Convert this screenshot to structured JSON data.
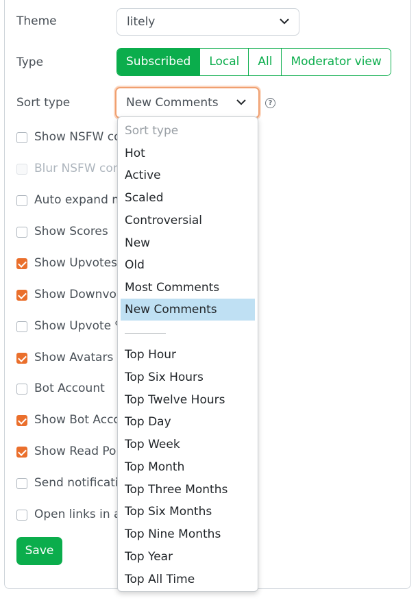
{
  "form": {
    "theme_label": "Theme",
    "theme_value": "litely",
    "type_label": "Type",
    "type_options": [
      "Subscribed",
      "Local",
      "All",
      "Moderator view"
    ],
    "type_selected": "Subscribed",
    "sort_label": "Sort type",
    "sort_value": "New Comments",
    "help_icon": "?",
    "save_label": "Save"
  },
  "checkboxes": [
    {
      "label": "Show NSFW co",
      "checked": false,
      "disabled": false
    },
    {
      "label": "Blur NSFW con",
      "checked": false,
      "disabled": true
    },
    {
      "label": "Auto expand m",
      "checked": false,
      "disabled": false
    },
    {
      "label": "Show Scores",
      "checked": false,
      "disabled": false
    },
    {
      "label": "Show Upvotes",
      "checked": true,
      "disabled": false
    },
    {
      "label": "Show Downvo",
      "checked": true,
      "disabled": false
    },
    {
      "label": "Show Upvote %",
      "checked": false,
      "disabled": false
    },
    {
      "label": "Show Avatars",
      "checked": true,
      "disabled": false
    },
    {
      "label": "Bot Account",
      "checked": false,
      "disabled": false
    },
    {
      "label": "Show Bot Acco",
      "checked": true,
      "disabled": false
    },
    {
      "label": "Show Read Po",
      "checked": true,
      "disabled": false
    },
    {
      "label": "Send notificati",
      "checked": false,
      "disabled": false
    },
    {
      "label": "Open links in a",
      "checked": false,
      "disabled": false
    }
  ],
  "dropdown": {
    "header": "Sort type",
    "options": [
      "Hot",
      "Active",
      "Scaled",
      "Controversial",
      "New",
      "Old",
      "Most Comments",
      "New Comments"
    ],
    "separator": "────────",
    "options2": [
      "Top Hour",
      "Top Six Hours",
      "Top Twelve Hours",
      "Top Day",
      "Top Week",
      "Top Month",
      "Top Three Months",
      "Top Six Months",
      "Top Nine Months",
      "Top Year",
      "Top All Time"
    ],
    "selected": "New Comments"
  },
  "colors": {
    "accent": "#0bad4c",
    "checkbox": "#ea6f2c",
    "focus": "#f0a070",
    "highlight": "#bfe0f3"
  }
}
